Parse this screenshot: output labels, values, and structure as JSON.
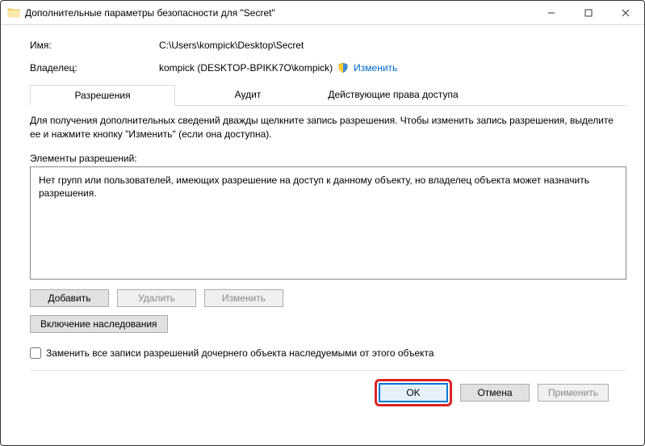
{
  "title": "Дополнительные параметры безопасности  для \"Secret\"",
  "labels": {
    "name": "Имя:",
    "owner": "Владелец:"
  },
  "values": {
    "path": "C:\\Users\\kompick\\Desktop\\Secret",
    "owner": "kompick (DESKTOP-BPIKK7O\\kompick)",
    "change_link": "Изменить"
  },
  "tabs": {
    "permissions": "Разрешения",
    "audit": "Аудит",
    "effective": "Действующие права доступа"
  },
  "hint": "Для получения дополнительных сведений дважды щелкните запись разрешения. Чтобы изменить запись разрешения, выделите ее и нажмите кнопку \"Изменить\" (если она доступна).",
  "list_label": "Элементы разрешений:",
  "list_empty": "Нет групп или пользователей, имеющих разрешение на доступ к данному объекту, но владелец объекта может назначить разрешения.",
  "buttons": {
    "add": "Добавить",
    "remove": "Удалить",
    "edit": "Изменить",
    "enable_inherit": "Включение наследования",
    "ok": "OK",
    "cancel": "Отмена",
    "apply": "Применить"
  },
  "checkbox_label": "Заменить все записи разрешений дочернего объекта наследуемыми от этого объекта"
}
